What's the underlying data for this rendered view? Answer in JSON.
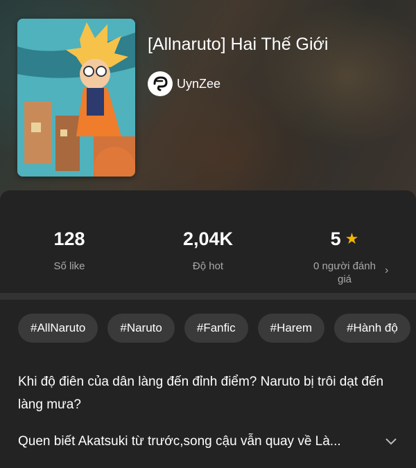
{
  "story": {
    "title": "[Allnaruto] Hai Thế Giới",
    "author": "UynZee"
  },
  "stats": [
    {
      "value": "128",
      "label": "Số like"
    },
    {
      "value": "2,04K",
      "label": "Độ hot"
    },
    {
      "value": "5",
      "label": "0 người đánh giá"
    }
  ],
  "tags": [
    "#AllNaruto",
    "#Naruto",
    "#Fanfic",
    "#Harem",
    "#Hành độ"
  ],
  "description": {
    "line1": "Khi độ điên của dân làng đến đỉnh điểm? Naruto bị trôi dạt đến làng mưa?",
    "line2": "Quen biết Akatsuki từ trước,song cậu vẫn quay về Là..."
  },
  "icons": {
    "rating": "star-icon",
    "more": "chevron-right-icon",
    "expand": "chevron-down-icon"
  }
}
